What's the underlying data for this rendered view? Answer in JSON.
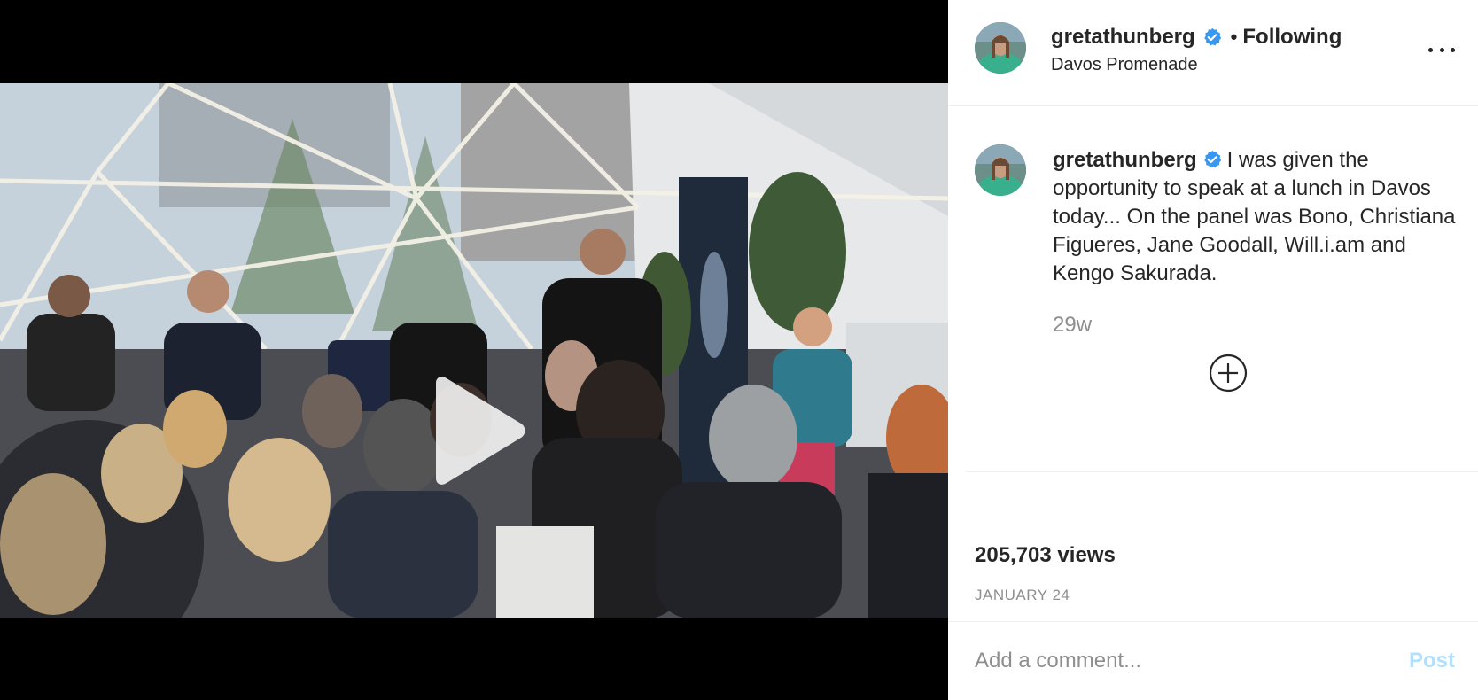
{
  "header": {
    "username": "gretathunberg",
    "separator": "•",
    "follow_status": "Following",
    "location": "Davos Promenade"
  },
  "caption": {
    "username": "gretathunberg",
    "text": "I was given the opportunity to speak at a lunch in Davos today... On the panel was Bono, Christiana Figueres, Jane Goodall, Will.i.am and Kengo Sakurada.",
    "time_ago": "29w"
  },
  "stats": {
    "views": "205,703 views",
    "date": "JANUARY 24"
  },
  "comment": {
    "placeholder": "Add a comment...",
    "post_label": "Post"
  },
  "colors": {
    "verified": "#3897f0",
    "post_disabled": "#b2dffc",
    "muted_text": "#8e8e8e"
  },
  "icons": [
    "verified-badge-icon",
    "more-options-icon",
    "load-more-comments-icon",
    "play-icon"
  ]
}
